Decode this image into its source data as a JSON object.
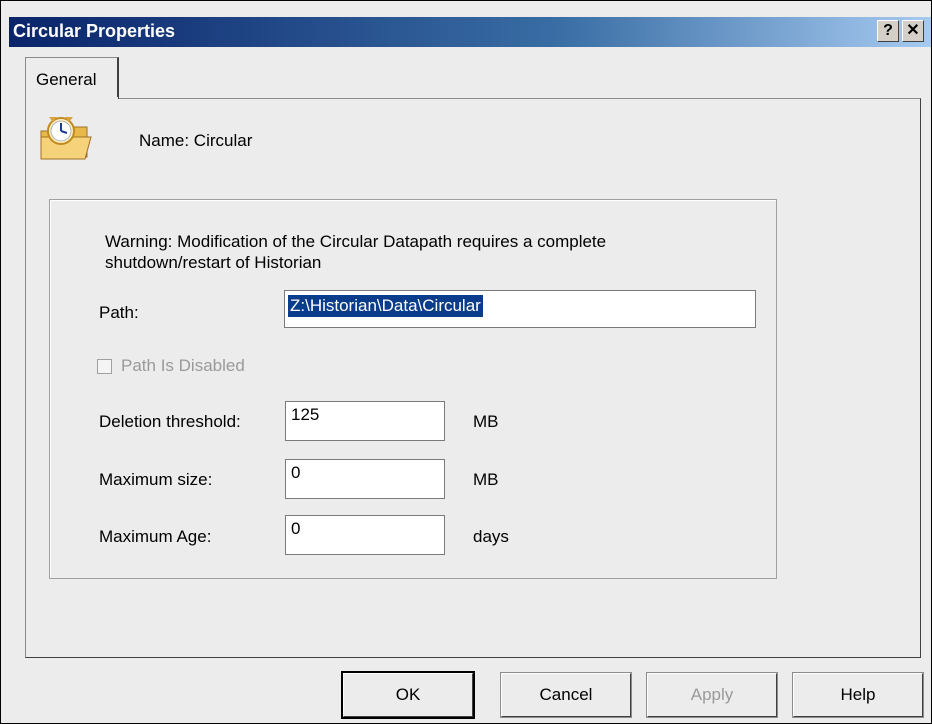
{
  "window": {
    "title": "Circular Properties",
    "help_glyph": "?",
    "close_glyph": "✕"
  },
  "tabs": [
    {
      "label": "General",
      "active": true
    }
  ],
  "general": {
    "icon": "clock-folder-icon",
    "name_label": "Name: Circular",
    "warning": "Warning: Modification of the Circular Datapath requires a complete shutdown/restart of Historian",
    "path_label": "Path:",
    "path_value": "Z:\\Historian\\Data\\Circular",
    "path_disabled_label": "Path Is Disabled",
    "path_disabled_checked": false,
    "deletion_threshold_label": "Deletion threshold:",
    "deletion_threshold_value": "125",
    "deletion_threshold_unit": "MB",
    "maximum_size_label": "Maximum size:",
    "maximum_size_value": "0",
    "maximum_size_unit": "MB",
    "maximum_age_label": "Maximum Age:",
    "maximum_age_value": "0",
    "maximum_age_unit": "days"
  },
  "buttons": {
    "ok": "OK",
    "cancel": "Cancel",
    "apply": "Apply",
    "help": "Help"
  }
}
